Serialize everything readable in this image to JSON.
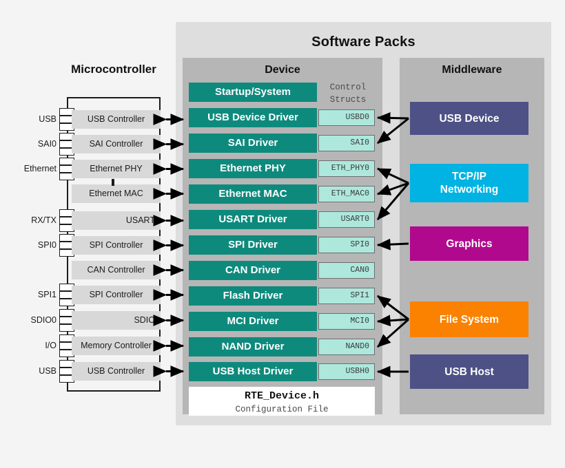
{
  "diagram": {
    "title": "Software Packs",
    "columns": {
      "microcontroller": "Microcontroller",
      "device": "Device",
      "middleware": "Middleware"
    },
    "control_structs_header": "Control\nStructs",
    "control_structs_header_line1": "Control",
    "control_structs_header_line2": "Structs"
  },
  "microcontroller": {
    "title": "Microcontroller",
    "peripherals": [
      {
        "name": "USB  Controller",
        "pin": "USB",
        "align": "center"
      },
      {
        "name": "SAI Controller",
        "pin": "SAI0",
        "align": "center"
      },
      {
        "name": "Ethernet  PHY",
        "pin": "Ethernet",
        "align": "center"
      },
      {
        "name": "Ethernet  MAC",
        "pin": "",
        "align": "center"
      },
      {
        "name": "USART",
        "pin": "RX/TX",
        "align": "right"
      },
      {
        "name": "SPI Controller",
        "pin": "SPI0",
        "align": "center"
      },
      {
        "name": "CAN Controller",
        "pin": "",
        "align": "center"
      },
      {
        "name": "SPI Controller",
        "pin": "SPI1",
        "align": "center"
      },
      {
        "name": "SDIO",
        "pin": "SDIO0",
        "align": "right"
      },
      {
        "name": "Memory Controller",
        "pin": "I/O",
        "align": "center"
      },
      {
        "name": "USB  Controller",
        "pin": "USB",
        "align": "center"
      }
    ]
  },
  "device": {
    "title": "Device",
    "startup": {
      "label": "Startup/System"
    },
    "drivers": [
      {
        "label": "USB Device Driver",
        "struct": "USBD0"
      },
      {
        "label": "SAI Driver",
        "struct": "SAI0"
      },
      {
        "label": "Ethernet PHY",
        "struct": "ETH_PHY0"
      },
      {
        "label": "Ethernet MAC",
        "struct": "ETH_MAC0"
      },
      {
        "label": "USART Driver",
        "struct": "USART0"
      },
      {
        "label": "SPI Driver",
        "struct": "SPI0"
      },
      {
        "label": "CAN Driver",
        "struct": "CAN0"
      },
      {
        "label": "Flash Driver",
        "struct": "SPI1"
      },
      {
        "label": "MCI Driver",
        "struct": "MCI0"
      },
      {
        "label": "NAND Driver",
        "struct": "NAND0"
      },
      {
        "label": "USB Host Driver",
        "struct": "USBH0"
      }
    ],
    "config_file": {
      "name": "RTE_Device.h",
      "subtitle": "Configuration File"
    }
  },
  "middleware": {
    "title": "Middleware",
    "blocks": [
      {
        "label": "USB Device",
        "color": "#4d5186",
        "lines": [
          "USB Device"
        ]
      },
      {
        "label": "TCP/IP Networking",
        "color": "#00b3e3",
        "lines": [
          "TCP/IP",
          "Networking"
        ]
      },
      {
        "label": "Graphics",
        "color": "#b1098e",
        "lines": [
          "Graphics"
        ]
      },
      {
        "label": "File System",
        "color": "#fa8200",
        "lines": [
          "File System"
        ]
      },
      {
        "label": "USB Host",
        "color": "#4d5186",
        "lines": [
          "USB Host"
        ]
      }
    ]
  },
  "colors": {
    "driver_teal": "#0e8a7d",
    "struct_mint": "#aee8dd",
    "panel_outer": "#dedede",
    "panel_column": "#b6b6b6",
    "page_background": "#f4f4f4",
    "outline": "#1b1b1b"
  },
  "connections": {
    "mcu_to_driver": "bidirectional",
    "middleware_links": [
      {
        "from": "USB Device",
        "to": [
          "USBD0",
          "SAI0"
        ]
      },
      {
        "from": "TCP/IP Networking",
        "to": [
          "ETH_PHY0",
          "ETH_MAC0",
          "USART0"
        ]
      },
      {
        "from": "Graphics",
        "to": [
          "SPI0"
        ]
      },
      {
        "from": "File System",
        "to": [
          "SPI1",
          "MCI0",
          "NAND0"
        ]
      },
      {
        "from": "USB Host",
        "to": [
          "USBH0"
        ]
      }
    ]
  }
}
